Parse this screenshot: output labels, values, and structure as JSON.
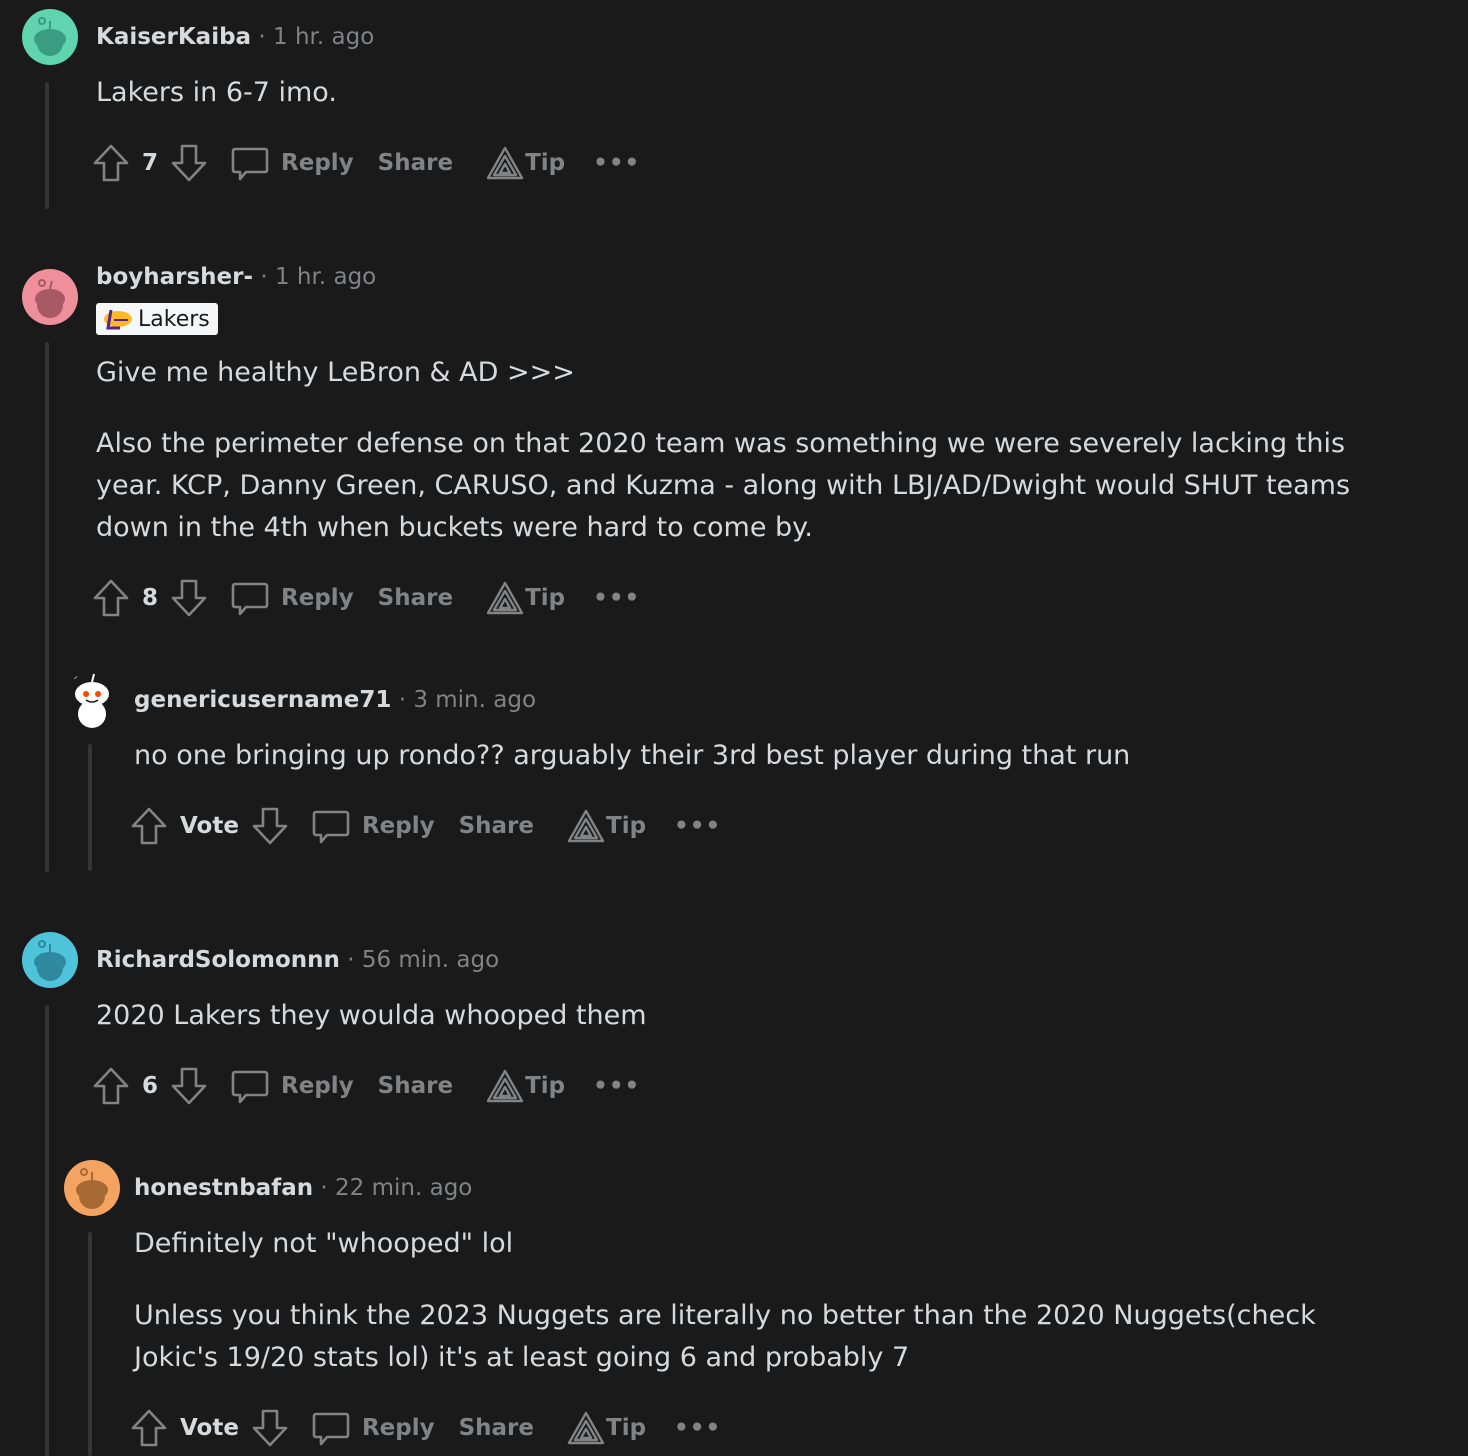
{
  "comments": [
    {
      "user": "KaiserKaiba",
      "time": "1 hr. ago",
      "body": [
        "Lakers in 6-7 imo."
      ],
      "score": "7",
      "avatar_color": "#5fd4ae"
    },
    {
      "user": "boyharsher-",
      "time": "1 hr. ago",
      "flair": "Lakers",
      "body": [
        "Give me healthy LeBron & AD >>>",
        "Also the perimeter defense on that 2020 team was something we were severely lacking this year. KCP, Danny Green, CARUSO, and Kuzma - along with LBJ/AD/Dwight would SHUT teams down in the 4th when buckets were hard to come by."
      ],
      "score": "8",
      "avatar_color": "#ee8f9a"
    },
    {
      "user": "genericusername71",
      "time": "3 min. ago",
      "body": [
        "no one bringing up rondo?? arguably their 3rd best player during that run"
      ],
      "score": "Vote",
      "avatar_color": "#ffffff"
    },
    {
      "user": "RichardSolomonnn",
      "time": "56 min. ago",
      "body": [
        "2020 Lakers they woulda whooped them"
      ],
      "score": "6",
      "avatar_color": "#4fc3d9"
    },
    {
      "user": "honestnbafan",
      "time": "22 min. ago",
      "body": [
        "Definitely not \"whooped\" lol",
        "Unless you think the 2023 Nuggets are literally no better than the 2020 Nuggets(check Jokic's 19/20 stats lol) it's at least going 6 and probably 7"
      ],
      "score": "Vote",
      "avatar_color": "#f4a460"
    }
  ],
  "actions": {
    "reply": "Reply",
    "share": "Share",
    "tip": "Tip",
    "more": "•••"
  },
  "separator": "·"
}
